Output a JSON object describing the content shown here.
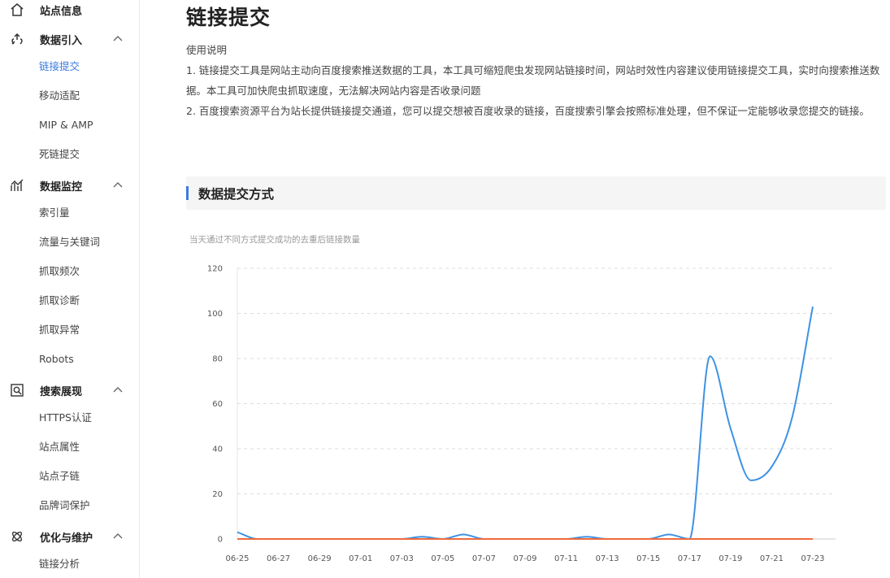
{
  "sidebar": {
    "groups": [
      {
        "label": "站点信息",
        "icon": "home-icon",
        "items": []
      },
      {
        "label": "数据引入",
        "icon": "link-upload-icon",
        "expanded": true,
        "items": [
          {
            "label": "链接提交",
            "active": true
          },
          {
            "label": "移动适配"
          },
          {
            "label": "MIP & AMP"
          },
          {
            "label": "死链提交"
          }
        ]
      },
      {
        "label": "数据监控",
        "icon": "monitor-chart-icon",
        "expanded": true,
        "items": [
          {
            "label": "索引量"
          },
          {
            "label": "流量与关键词"
          },
          {
            "label": "抓取频次"
          },
          {
            "label": "抓取诊断"
          },
          {
            "label": "抓取异常"
          },
          {
            "label": "Robots"
          }
        ]
      },
      {
        "label": "搜索展现",
        "icon": "search-display-icon",
        "expanded": true,
        "items": [
          {
            "label": "HTTPS认证"
          },
          {
            "label": "站点属性"
          },
          {
            "label": "站点子链"
          },
          {
            "label": "品牌词保护"
          }
        ]
      },
      {
        "label": "优化与维护",
        "icon": "optimize-icon",
        "expanded": true,
        "items": [
          {
            "label": "链接分析"
          }
        ]
      }
    ]
  },
  "main": {
    "title": "链接提交",
    "instructions_heading": "使用说明",
    "instructions_line1": "1. 链接提交工具是网站主动向百度搜索推送数据的工具，本工具可缩短爬虫发现网站链接时间，网站时效性内容建议使用链接提交工具，实时向搜索推送数据。本工具可加快爬虫抓取速度，无法解决网站内容是否收录问题",
    "instructions_line2": "2. 百度搜索资源平台为站长提供链接提交通道，您可以提交想被百度收录的链接，百度搜索引擎会按照标准处理，但不保证一定能够收录您提交的链接。",
    "section_title": "数据提交方式",
    "chart_subtitle": "当天通过不同方式提交成功的去重后链接数量"
  },
  "colors": {
    "accent": "#3b7be0",
    "series_blue": "#3d92e3",
    "series_orange": "#f06a3c",
    "grid": "#dddddd"
  },
  "chart_data": {
    "type": "line",
    "title": "",
    "subtitle": "当天通过不同方式提交成功的去重后链接数量",
    "xlabel": "",
    "ylabel": "",
    "ylim": [
      0,
      120
    ],
    "yticks": [
      0,
      20,
      40,
      60,
      80,
      100,
      120
    ],
    "x_tick_labels": [
      "06-25",
      "06-27",
      "06-29",
      "07-01",
      "07-03",
      "07-05",
      "07-07",
      "07-09",
      "07-11",
      "07-13",
      "07-15",
      "07-17",
      "07-19",
      "07-21",
      "07-23"
    ],
    "x": [
      "06-25",
      "06-26",
      "06-27",
      "06-28",
      "06-29",
      "06-30",
      "07-01",
      "07-02",
      "07-03",
      "07-04",
      "07-05",
      "07-06",
      "07-07",
      "07-08",
      "07-09",
      "07-10",
      "07-11",
      "07-12",
      "07-13",
      "07-14",
      "07-15",
      "07-16",
      "07-17",
      "07-18",
      "07-19",
      "07-20",
      "07-21",
      "07-22",
      "07-23"
    ],
    "grid": true,
    "series": [
      {
        "color": "#3d92e3",
        "values": [
          3,
          0,
          0,
          0,
          0,
          0,
          0,
          0,
          0,
          1,
          0,
          2,
          0,
          0,
          0,
          0,
          0,
          1,
          0,
          0,
          0,
          2,
          0,
          81,
          49,
          26,
          32,
          54,
          103
        ]
      },
      {
        "color": "#f06a3c",
        "values": [
          0,
          0,
          0,
          0,
          0,
          0,
          0,
          0,
          0,
          0,
          0,
          0,
          0,
          0,
          0,
          0,
          0,
          0,
          0,
          0,
          0,
          0,
          0,
          0,
          0,
          0,
          0,
          0,
          0
        ]
      }
    ]
  }
}
